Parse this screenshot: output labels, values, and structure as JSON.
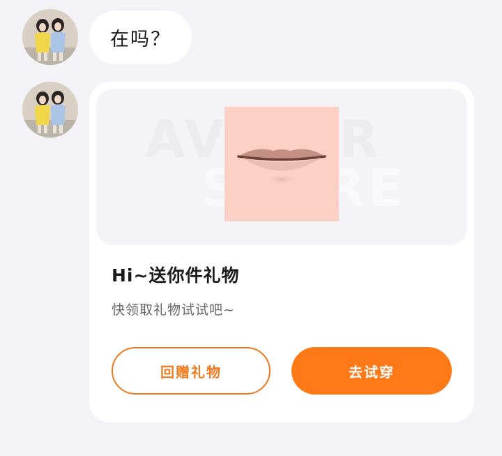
{
  "messages": [
    {
      "type": "text",
      "avatar_icon": "user-avatar-icon",
      "text": "在吗？"
    },
    {
      "type": "gift_card",
      "avatar_icon": "user-avatar-icon",
      "preview_icon": "lipstick-lips-icon",
      "watermark_lines": [
        "AVATAR",
        "STORE"
      ],
      "title": "Hi~送你件礼物",
      "subtitle": "快领取礼物试试吧~",
      "buttons": {
        "return_gift": "回赠礼物",
        "try_on": "去试穿"
      }
    }
  ],
  "colors": {
    "accent": "#ff7a16",
    "accent_outline": "#f07a1e",
    "background": "#f3f3f7",
    "card": "#ffffff"
  }
}
